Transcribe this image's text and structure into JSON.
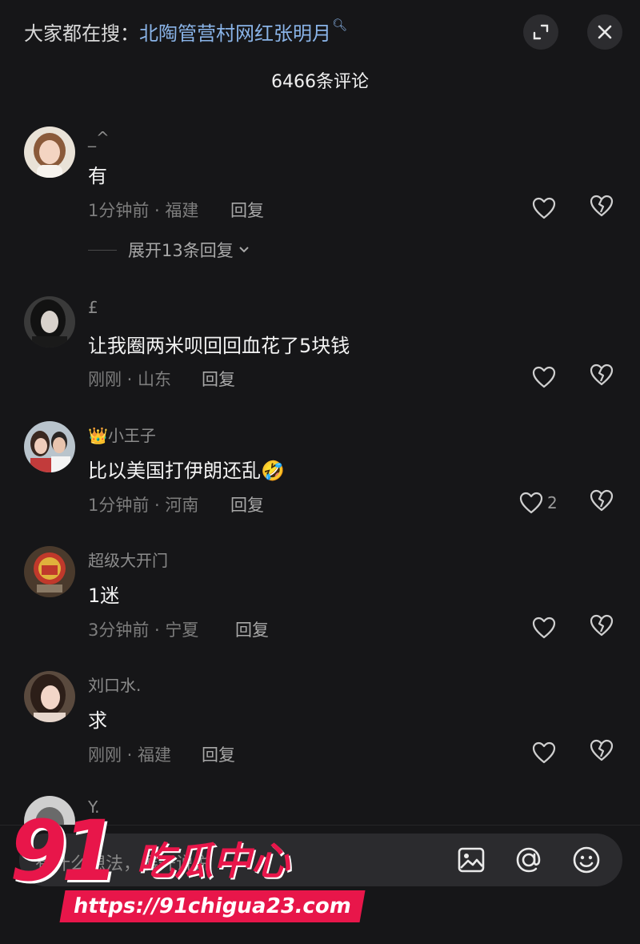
{
  "header": {
    "search_prefix": "大家都在搜：",
    "search_keyword": "北陶管营村网红张明月",
    "comment_count": "6466条评论"
  },
  "comments": [
    {
      "user": "_^",
      "text": "有",
      "time_loc": "1分钟前 · 福建",
      "reply": "回复",
      "likes": "",
      "expand": "展开13条回复"
    },
    {
      "user": "£",
      "text": "让我圈两米呗回回血花了5块钱",
      "time_loc": "刚刚 · 山东",
      "reply": "回复",
      "likes": ""
    },
    {
      "user": "小王子",
      "text": "比以美国打伊朗还乱",
      "time_loc": "1分钟前 · 河南",
      "reply": "回复",
      "likes": "2"
    },
    {
      "user": "超级大开门",
      "text": "1迷",
      "time_loc": "3分钟前 · 宁夏",
      "reply": "回复",
      "likes": ""
    },
    {
      "user": "刘口水.",
      "text": "求",
      "time_loc": "刚刚 · 福建",
      "reply": "回复",
      "likes": ""
    },
    {
      "user": "Y.",
      "text": "",
      "time_loc": "",
      "reply": "",
      "likes": ""
    }
  ],
  "input": {
    "placeholder": "有什么想法，展开说说"
  },
  "watermark": {
    "number": "91",
    "title": "吃瓜中心",
    "url": "https://91chigua23.com"
  },
  "colors": {
    "background": "#161618",
    "keyword": "#8ab4e8",
    "watermark": "#e8164a"
  }
}
